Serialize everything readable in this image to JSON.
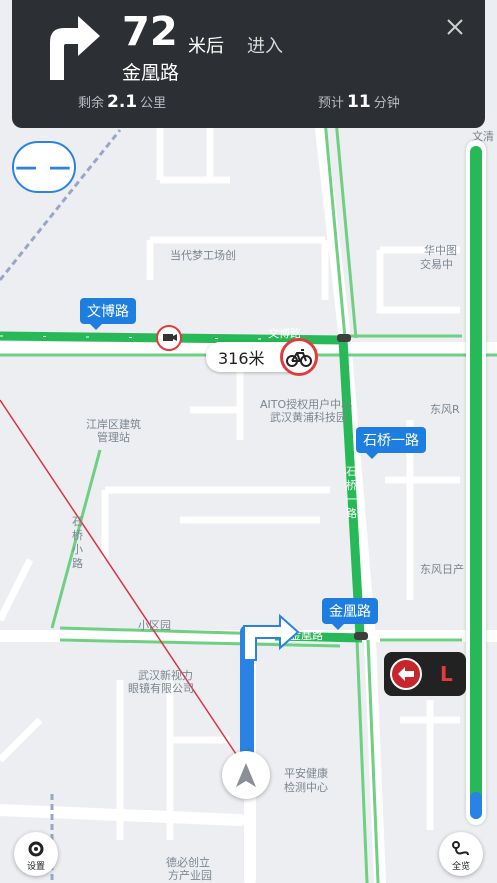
{
  "nav": {
    "distance_value": "72",
    "distance_unit": "米后",
    "action": "进入",
    "street": "金凰路",
    "remaining_label": "剩余",
    "remaining_value": "2.1",
    "remaining_unit": "公里",
    "eta_label": "预计",
    "eta_value": "11",
    "eta_unit": "分钟"
  },
  "map": {
    "road_tags": [
      "文博路",
      "石桥一路",
      "金凰路"
    ],
    "distance_badge": "316米",
    "pois": {
      "dangdai": "当代梦工场创",
      "aito_line1": "AITO授权用户中心",
      "aito_line2": "武汉黄浦科技园",
      "jiangan": "江岸区建筑",
      "jiangan2": "管理站",
      "huazhong": "华中图",
      "huazhong2": "交易中",
      "dongfeng1": "东风R",
      "dongfeng2": "东风日产",
      "xiaoxiao": "小区园",
      "glasses1": "武汉新视力",
      "glasses2": "眼镜有限公司",
      "health1": "平安健康",
      "health2": "检测中心",
      "desheng1": "德必创立",
      "desheng2": "方产业园",
      "wenqing": "文清",
      "wenbo_small": "文博路",
      "jinhuang_small": "金凰路",
      "shiqiao_vertical": "石桥一路",
      "shiqiao_xiao": "石桥小路"
    },
    "lane_text": "L"
  },
  "controls": {
    "settings_label": "设置",
    "overview_label": "全览",
    "dash_label": "— —"
  },
  "colors": {
    "route_green": "#27b857",
    "route_blue": "#2a82e4",
    "card_bg": "#2c2f33",
    "alert_red": "#e33b3b"
  },
  "progress": {
    "remaining_fraction": 0.96
  }
}
